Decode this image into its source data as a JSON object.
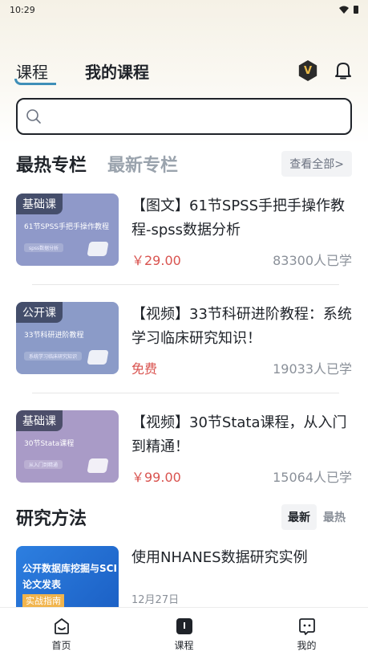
{
  "status_bar": {
    "time": "10:29"
  },
  "header": {
    "tab_course": "课程",
    "tab_my_course": "我的课程",
    "vip_letter": "V"
  },
  "search": {
    "placeholder": ""
  },
  "featured": {
    "tab_hot": "最热专栏",
    "tab_new": "最新专栏",
    "view_all": "查看全部>"
  },
  "courses": [
    {
      "tag": "基础课",
      "thumb_title": "61节SPSS手把手操作教程",
      "thumb_sub": "spss数据分析",
      "title": "【图文】61节SPSS手把手操作教程-spss数据分析",
      "price": "￥29.00",
      "learners": "83300人已学",
      "thumb_color": "#8f99c9"
    },
    {
      "tag": "公开课",
      "thumb_title": "33节科研进阶教程",
      "thumb_sub": "系统学习临床研究知识",
      "title": "【视频】33节科研进阶教程：系统学习临床研究知识！",
      "price": "免费",
      "learners": "19033人已学",
      "thumb_color": "#8b9bc8"
    },
    {
      "tag": "基础课",
      "thumb_title": "30节Stata课程",
      "thumb_sub": "从入门到精通",
      "title": "【视频】30节Stata课程，从入门到精通！",
      "price": "￥99.00",
      "learners": "15064人已学",
      "thumb_color": "#a99bc7"
    }
  ],
  "research_methods": {
    "title": "研究方法",
    "tab_latest": "最新",
    "tab_hot": "最热"
  },
  "article": {
    "thumb_line1": "公开数据库挖掘与SCI论文发表",
    "thumb_line2": "实战指南",
    "title": "使用NHANES数据研究实例",
    "date": "12月27日"
  },
  "bottom_nav": [
    {
      "label": "首页",
      "icon": "home-icon"
    },
    {
      "label": "课程",
      "icon": "course-icon"
    },
    {
      "label": "我的",
      "icon": "profile-icon"
    }
  ],
  "colors": {
    "accent": "#3f8fb8",
    "price": "#d9534f",
    "muted": "#8a9099"
  }
}
